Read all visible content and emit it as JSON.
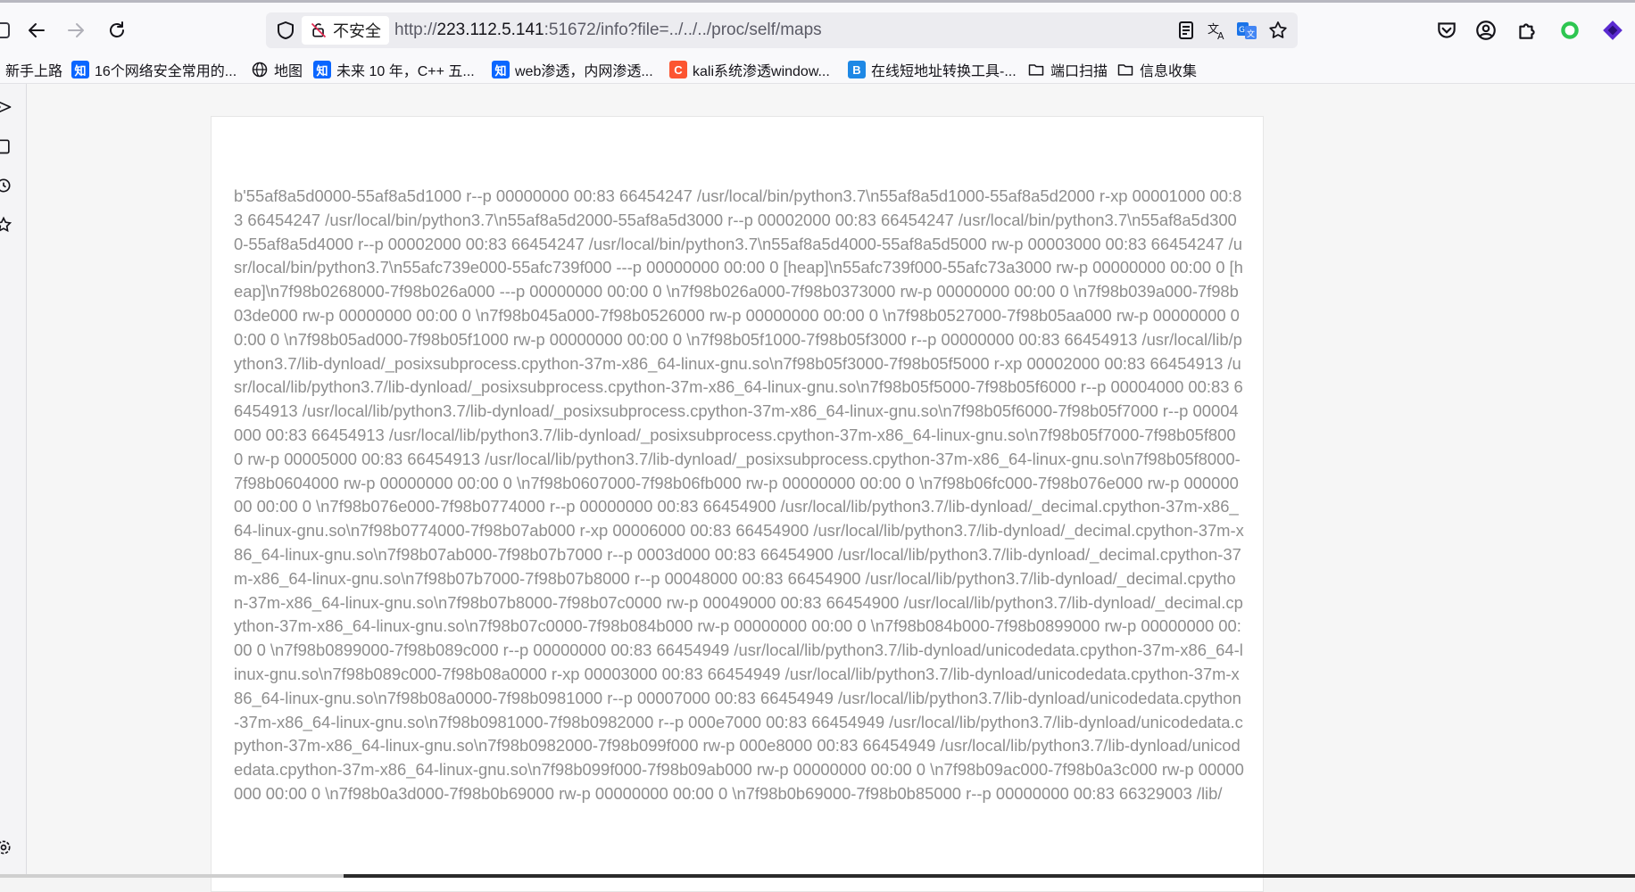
{
  "browser": {
    "security_label": "不安全",
    "url": {
      "scheme": "http://",
      "host": "223.112.5.141",
      "rest": ":51672/info?file=../../../proc/self/maps"
    },
    "accent_color": "#0060df"
  },
  "bookmarks": [
    {
      "label": "新手上路",
      "favicon": "none"
    },
    {
      "label": "16个网络安全常用的...",
      "favicon": "zhihu-icon"
    },
    {
      "label": "地图",
      "favicon": "globe-icon"
    },
    {
      "label": "未来 10 年，C++ 五...",
      "favicon": "zhihu-icon"
    },
    {
      "label": "web渗透，内网渗透...",
      "favicon": "zhihu-icon"
    },
    {
      "label": "kali系统渗透window...",
      "favicon": "csdn-icon"
    },
    {
      "label": "在线短地址转换工具-...",
      "favicon": "b-icon"
    },
    {
      "label": "端口扫描",
      "favicon": "folder-icon"
    },
    {
      "label": "信息收集",
      "favicon": "folder-icon"
    }
  ],
  "content": {
    "maps_text": "b'55af8a5d0000-55af8a5d1000 r--p 00000000 00:83 66454247 /usr/local/bin/python3.7\\n55af8a5d1000-55af8a5d2000 r-xp 00001000 00:83 66454247 /usr/local/bin/python3.7\\n55af8a5d2000-55af8a5d3000 r--p 00002000 00:83 66454247 /usr/local/bin/python3.7\\n55af8a5d3000-55af8a5d4000 r--p 00002000 00:83 66454247 /usr/local/bin/python3.7\\n55af8a5d4000-55af8a5d5000 rw-p 00003000 00:83 66454247 /usr/local/bin/python3.7\\n55afc739e000-55afc739f000 ---p 00000000 00:00 0 [heap]\\n55afc739f000-55afc73a3000 rw-p 00000000 00:00 0 [heap]\\n7f98b0268000-7f98b026a000 ---p 00000000 00:00 0 \\n7f98b026a000-7f98b0373000 rw-p 00000000 00:00 0 \\n7f98b039a000-7f98b03de000 rw-p 00000000 00:00 0 \\n7f98b045a000-7f98b0526000 rw-p 00000000 00:00 0 \\n7f98b0527000-7f98b05aa000 rw-p 00000000 00:00 0 \\n7f98b05ad000-7f98b05f1000 rw-p 00000000 00:00 0 \\n7f98b05f1000-7f98b05f3000 r--p 00000000 00:83 66454913 /usr/local/lib/python3.7/lib-dynload/_posixsubprocess.cpython-37m-x86_64-linux-gnu.so\\n7f98b05f3000-7f98b05f5000 r-xp 00002000 00:83 66454913 /usr/local/lib/python3.7/lib-dynload/_posixsubprocess.cpython-37m-x86_64-linux-gnu.so\\n7f98b05f5000-7f98b05f6000 r--p 00004000 00:83 66454913 /usr/local/lib/python3.7/lib-dynload/_posixsubprocess.cpython-37m-x86_64-linux-gnu.so\\n7f98b05f6000-7f98b05f7000 r--p 00004000 00:83 66454913 /usr/local/lib/python3.7/lib-dynload/_posixsubprocess.cpython-37m-x86_64-linux-gnu.so\\n7f98b05f7000-7f98b05f8000 rw-p 00005000 00:83 66454913 /usr/local/lib/python3.7/lib-dynload/_posixsubprocess.cpython-37m-x86_64-linux-gnu.so\\n7f98b05f8000-7f98b0604000 rw-p 00000000 00:00 0 \\n7f98b0607000-7f98b06fb000 rw-p 00000000 00:00 0 \\n7f98b06fc000-7f98b076e000 rw-p 00000000 00:00 0 \\n7f98b076e000-7f98b0774000 r--p 00000000 00:83 66454900 /usr/local/lib/python3.7/lib-dynload/_decimal.cpython-37m-x86_64-linux-gnu.so\\n7f98b0774000-7f98b07ab000 r-xp 00006000 00:83 66454900 /usr/local/lib/python3.7/lib-dynload/_decimal.cpython-37m-x86_64-linux-gnu.so\\n7f98b07ab000-7f98b07b7000 r--p 0003d000 00:83 66454900 /usr/local/lib/python3.7/lib-dynload/_decimal.cpython-37m-x86_64-linux-gnu.so\\n7f98b07b7000-7f98b07b8000 r--p 00048000 00:83 66454900 /usr/local/lib/python3.7/lib-dynload/_decimal.cpython-37m-x86_64-linux-gnu.so\\n7f98b07b8000-7f98b07c0000 rw-p 00049000 00:83 66454900 /usr/local/lib/python3.7/lib-dynload/_decimal.cpython-37m-x86_64-linux-gnu.so\\n7f98b07c0000-7f98b084b000 rw-p 00000000 00:00 0 \\n7f98b084b000-7f98b0899000 rw-p 00000000 00:00 0 \\n7f98b0899000-7f98b089c000 r--p 00000000 00:83 66454949 /usr/local/lib/python3.7/lib-dynload/unicodedata.cpython-37m-x86_64-linux-gnu.so\\n7f98b089c000-7f98b08a0000 r-xp 00003000 00:83 66454949 /usr/local/lib/python3.7/lib-dynload/unicodedata.cpython-37m-x86_64-linux-gnu.so\\n7f98b08a0000-7f98b0981000 r--p 00007000 00:83 66454949 /usr/local/lib/python3.7/lib-dynload/unicodedata.cpython-37m-x86_64-linux-gnu.so\\n7f98b0981000-7f98b0982000 r--p 000e7000 00:83 66454949 /usr/local/lib/python3.7/lib-dynload/unicodedata.cpython-37m-x86_64-linux-gnu.so\\n7f98b0982000-7f98b099f000 rw-p 000e8000 00:83 66454949 /usr/local/lib/python3.7/lib-dynload/unicodedata.cpython-37m-x86_64-linux-gnu.so\\n7f98b099f000-7f98b09ab000 rw-p 00000000 00:00 0 \\n7f98b09ac000-7f98b0a3c000 rw-p 00000000 00:00 0 \\n7f98b0a3d000-7f98b0b69000 rw-p 00000000 00:00 0 \\n7f98b0b69000-7f98b0b85000 r--p 00000000 00:83 66329003 /lib/"
  }
}
